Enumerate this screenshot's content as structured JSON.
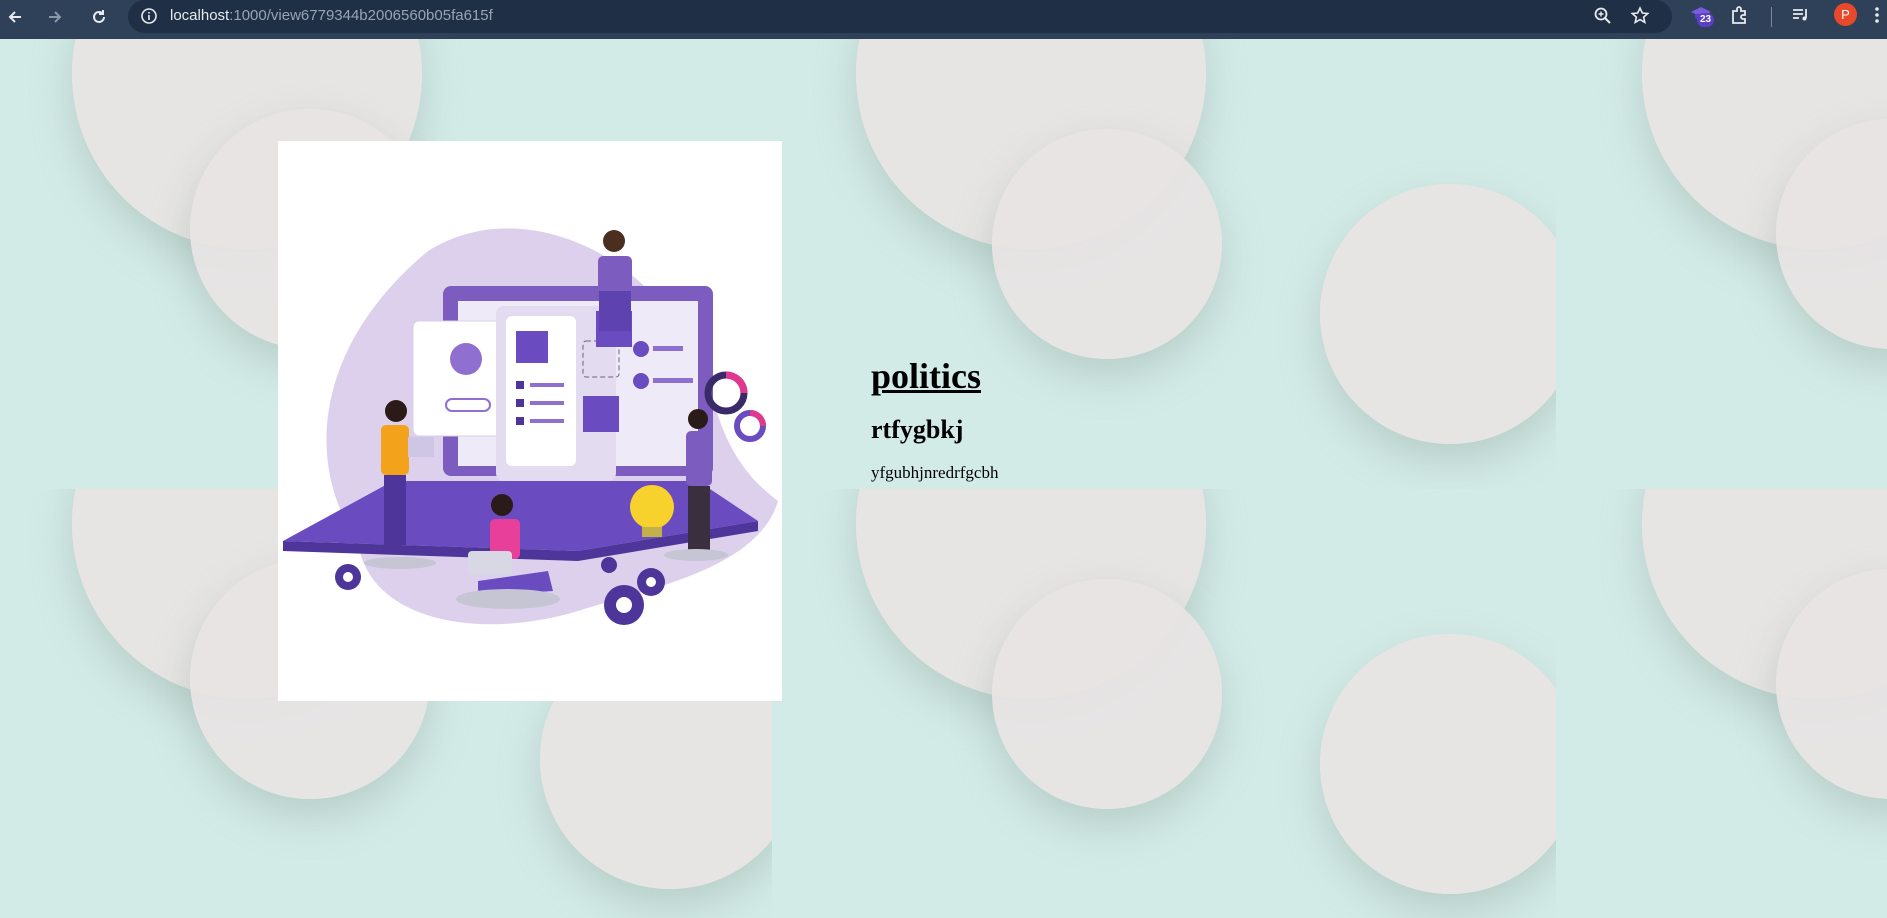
{
  "browser": {
    "url_host": "localhost",
    "url_path": ":1000/view6779344b2006560b05fa615f",
    "extension_badge": "23",
    "profile_initial": "P"
  },
  "icons": {
    "back": "arrow-left-icon",
    "forward": "arrow-right-icon",
    "reload": "reload-icon",
    "site_info": "info-icon",
    "zoom": "zoom-icon",
    "bookmark": "star-icon",
    "extension": "extension-puzzle-icon",
    "media": "media-queue-icon",
    "menu": "kebab-menu-icon"
  },
  "content": {
    "title": "politics",
    "subtitle": "rtfygbkj",
    "body": "yfgubhjnredrfgcbh"
  },
  "colors": {
    "chrome": "#2f4159",
    "omnibox": "#1f2f45",
    "page_bg": "#d5ebe7",
    "illustration_purple": "#6a4cc0"
  }
}
